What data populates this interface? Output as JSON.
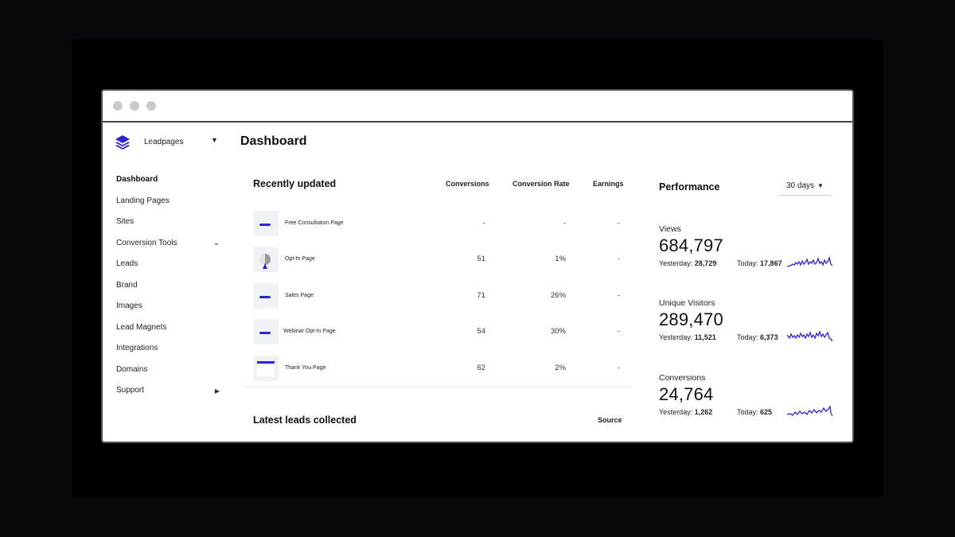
{
  "brand": {
    "name": "Leadpages",
    "accent": "#2f25d6"
  },
  "nav": {
    "items": [
      {
        "label": "Dashboard",
        "active": true
      },
      {
        "label": "Landing Pages"
      },
      {
        "label": "Sites"
      },
      {
        "label": "Conversion Tools",
        "arrow": "chevron-down"
      },
      {
        "label": "Leads"
      },
      {
        "label": "Brand"
      },
      {
        "label": "Images"
      },
      {
        "label": "Lead Magnets"
      },
      {
        "label": "Integrations"
      },
      {
        "label": "Domains"
      },
      {
        "label": "Support",
        "arrow": "caret-right"
      }
    ]
  },
  "page": {
    "title": "Dashboard"
  },
  "recent": {
    "title": "Recently updated",
    "columns": {
      "conversions": "Conversions",
      "rate": "Conversion Rate",
      "earnings": "Earnings"
    },
    "rows": [
      {
        "name": "Free Consultation Page",
        "conversions": "-",
        "rate": "-",
        "earnings": "-"
      },
      {
        "name": "Opt-In Page",
        "conversions": "51",
        "rate": "1%",
        "earnings": "-"
      },
      {
        "name": "Sales Page",
        "conversions": "71",
        "rate": "26%",
        "earnings": "-"
      },
      {
        "name": "Webinar Opt-In Page",
        "conversions": "54",
        "rate": "30%",
        "earnings": "-"
      },
      {
        "name": "Thank You Page",
        "conversions": "62",
        "rate": "2%",
        "earnings": "-"
      }
    ]
  },
  "leads": {
    "title": "Latest leads collected",
    "source_label": "Source"
  },
  "performance": {
    "title": "Performance",
    "range": "30 days",
    "metrics": [
      {
        "label": "Views",
        "value": "684,797",
        "yesterday_label": "Yesterday:",
        "yesterday": "28,729",
        "today_label": "Today:",
        "today": "17,867"
      },
      {
        "label": "Unique Visitors",
        "value": "289,470",
        "yesterday_label": "Yesterday:",
        "yesterday": "11,521",
        "today_label": "Today:",
        "today": "6,373"
      },
      {
        "label": "Conversions",
        "value": "24,764",
        "yesterday_label": "Yesterday:",
        "yesterday": "1,262",
        "today_label": "Today:",
        "today": "625"
      }
    ]
  }
}
